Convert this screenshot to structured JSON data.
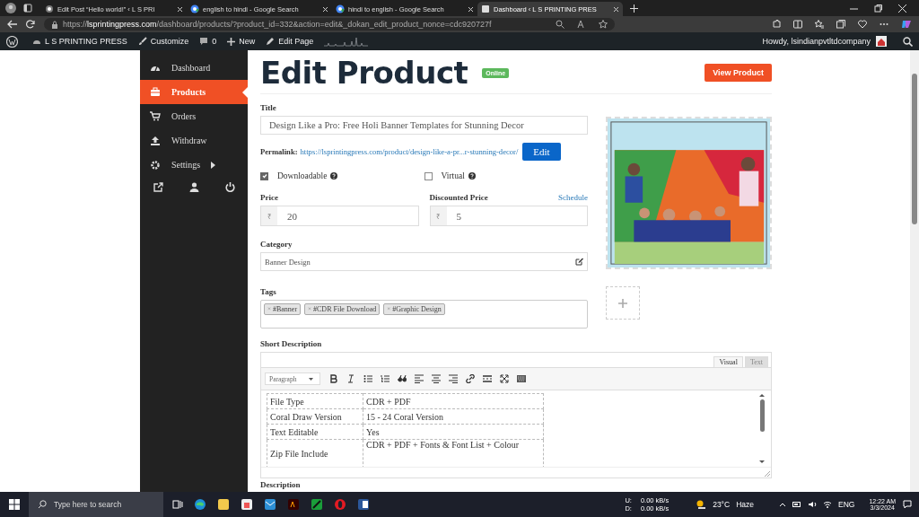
{
  "browser": {
    "tabs": [
      {
        "label": "Edit Post “Hello world!” ‹ L S PRI",
        "selected": false
      },
      {
        "label": "english to hindi - Google Search",
        "selected": false
      },
      {
        "label": "hindi to english - Google Search",
        "selected": false
      },
      {
        "label": "Dashboard ‹ L S PRINTING PRES",
        "selected": true
      }
    ],
    "url": "https://lsprintingpress.com/dashboard/products/?product_id=332&action=edit&_dokan_edit_product_nonce=cdc920727f"
  },
  "admin_bar": {
    "site": "L S PRINTING PRESS",
    "items": [
      "Customize",
      "0",
      "New",
      "Edit Page"
    ],
    "greeting": "Howdy, lsindianpvtltdcompany"
  },
  "sidebar": {
    "items": [
      {
        "label": "Dashboard",
        "selected": false
      },
      {
        "label": "Products",
        "selected": true
      },
      {
        "label": "Orders",
        "selected": false
      },
      {
        "label": "Withdraw",
        "selected": false
      },
      {
        "label": "Settings",
        "selected": false
      }
    ]
  },
  "page": {
    "title": "Edit Product",
    "status": "Online",
    "view_button": "View Product"
  },
  "form": {
    "title": {
      "label": "Title",
      "value": "Design Like a Pro: Free Holi Banner Templates for Stunning Decor"
    },
    "permalink": {
      "label": "Permalink:",
      "url": "https://lsprintingpress.com/product/design-like-a-pr...r-stunning-decor/",
      "button": "Edit"
    },
    "options": [
      {
        "label": "Downloadable",
        "checked": true
      },
      {
        "label": "Virtual",
        "checked": false
      }
    ],
    "prices": [
      {
        "label": "Price",
        "currency": "₹",
        "value": "20"
      },
      {
        "label": "Discounted Price",
        "link": "Schedule",
        "currency": "₹",
        "value": "5"
      }
    ],
    "category": {
      "label": "Category",
      "value": "Banner Design"
    },
    "tags": {
      "label": "Tags",
      "items": [
        {
          "remove": "×",
          "label": "#Banner"
        },
        {
          "remove": "×",
          "label": "#CDR File Download"
        },
        {
          "remove": "×",
          "label": "#Graphic Design"
        }
      ]
    },
    "short_description": {
      "label": "Short Description",
      "modes": [
        {
          "label": "Visual",
          "selected": true
        },
        {
          "label": "Text",
          "selected": false
        }
      ],
      "format": "Paragraph",
      "rows": [
        [
          "File Type",
          "CDR + PDF"
        ],
        [
          "Coral Draw Version",
          "15 - 24 Coral Version"
        ],
        [
          "Text Editable",
          "Yes"
        ],
        [
          "Zip File Include",
          "CDR + PDF + Fonts & Font List + Colour"
        ]
      ]
    },
    "description_label": "Description"
  },
  "taskbar": {
    "search_placeholder": "Type here to search",
    "network": [
      {
        "label": "U:",
        "value": "0.00 kB/s"
      },
      {
        "label": "D:",
        "value": "0.00 kB/s"
      }
    ],
    "temperature": "23°C",
    "weather": "Haze",
    "language": "ENG",
    "time": "12:22 AM",
    "date": "3/3/2024"
  }
}
